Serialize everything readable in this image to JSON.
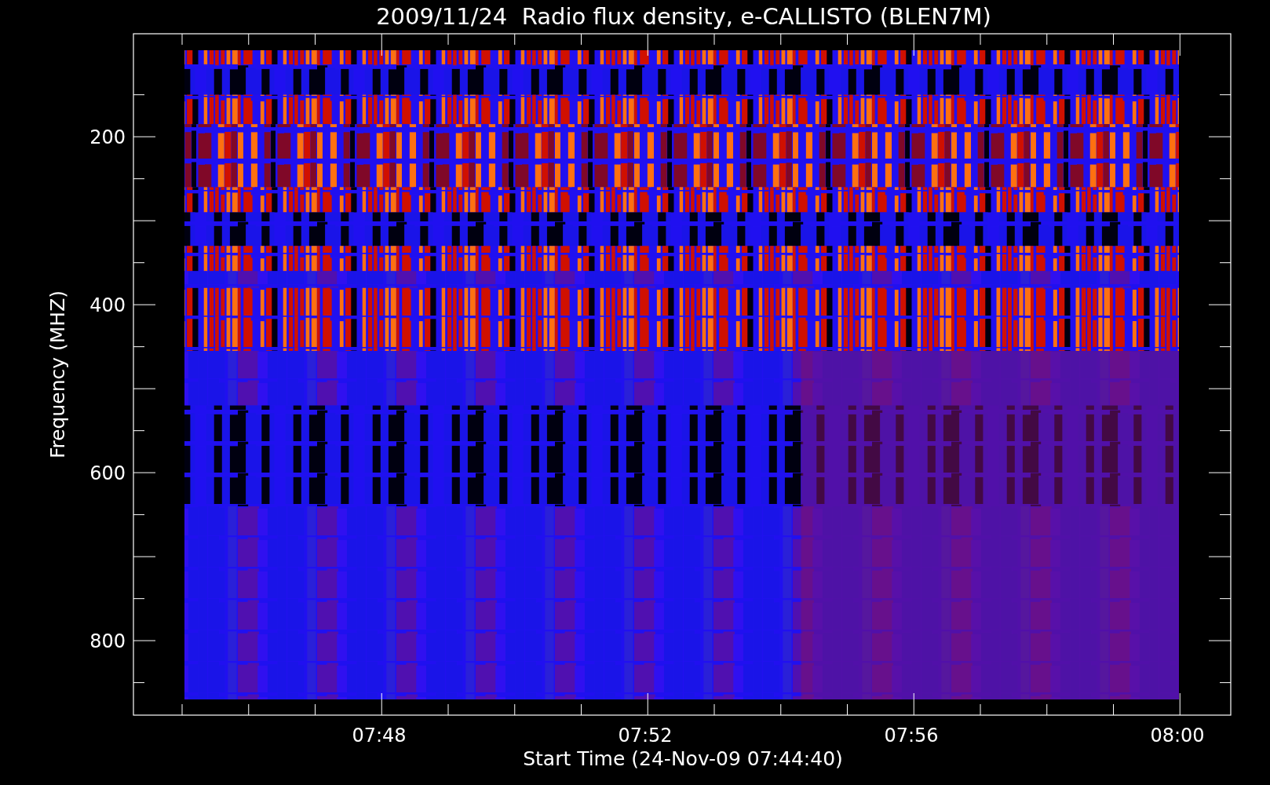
{
  "title": "2009/11/24  Radio flux density, e-CALLISTO (BLEN7M)",
  "y_axis": {
    "label": "Frequency (MHZ)",
    "ticks": [
      "200",
      "400",
      "600",
      "800"
    ]
  },
  "x_axis": {
    "label": "Start Time (24-Nov-09 07:44:40)",
    "ticks": [
      "07:48",
      "07:52",
      "07:56",
      "08:00"
    ]
  }
}
